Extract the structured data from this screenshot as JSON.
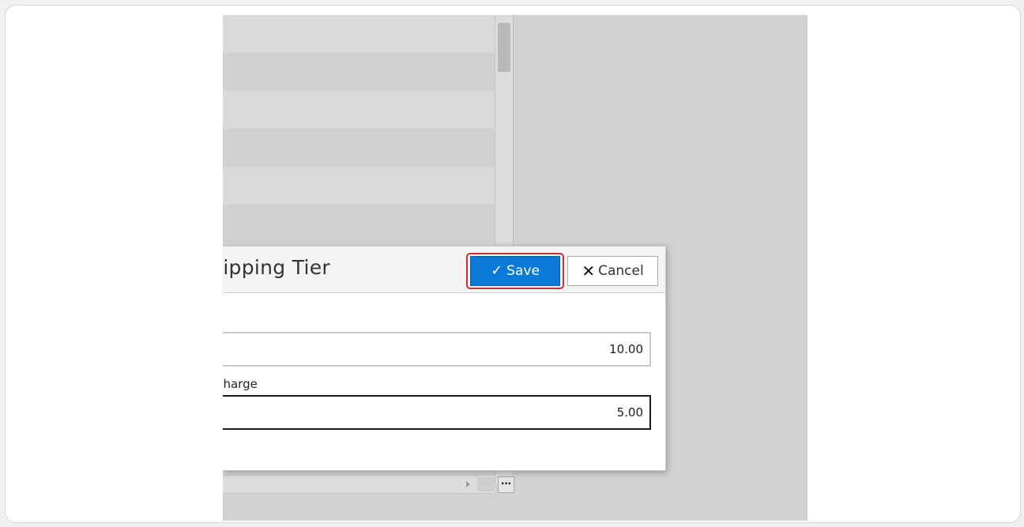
{
  "dialog": {
    "title": "Shipping Tier",
    "save_label": "Save",
    "cancel_label": "Cancel",
    "fields": [
      {
        "label": "",
        "value": "10.00"
      },
      {
        "label": "Charge",
        "value": "5.00"
      }
    ]
  },
  "list": {
    "more_label": "…"
  },
  "colors": {
    "save_bg": "#0a7ad6",
    "highlight_outline": "#c9303a",
    "overlay_bg": "#d2d2d2"
  },
  "icons": {
    "save": "check-icon",
    "cancel": "close-icon",
    "scroll_right": "chevron-right-icon"
  }
}
